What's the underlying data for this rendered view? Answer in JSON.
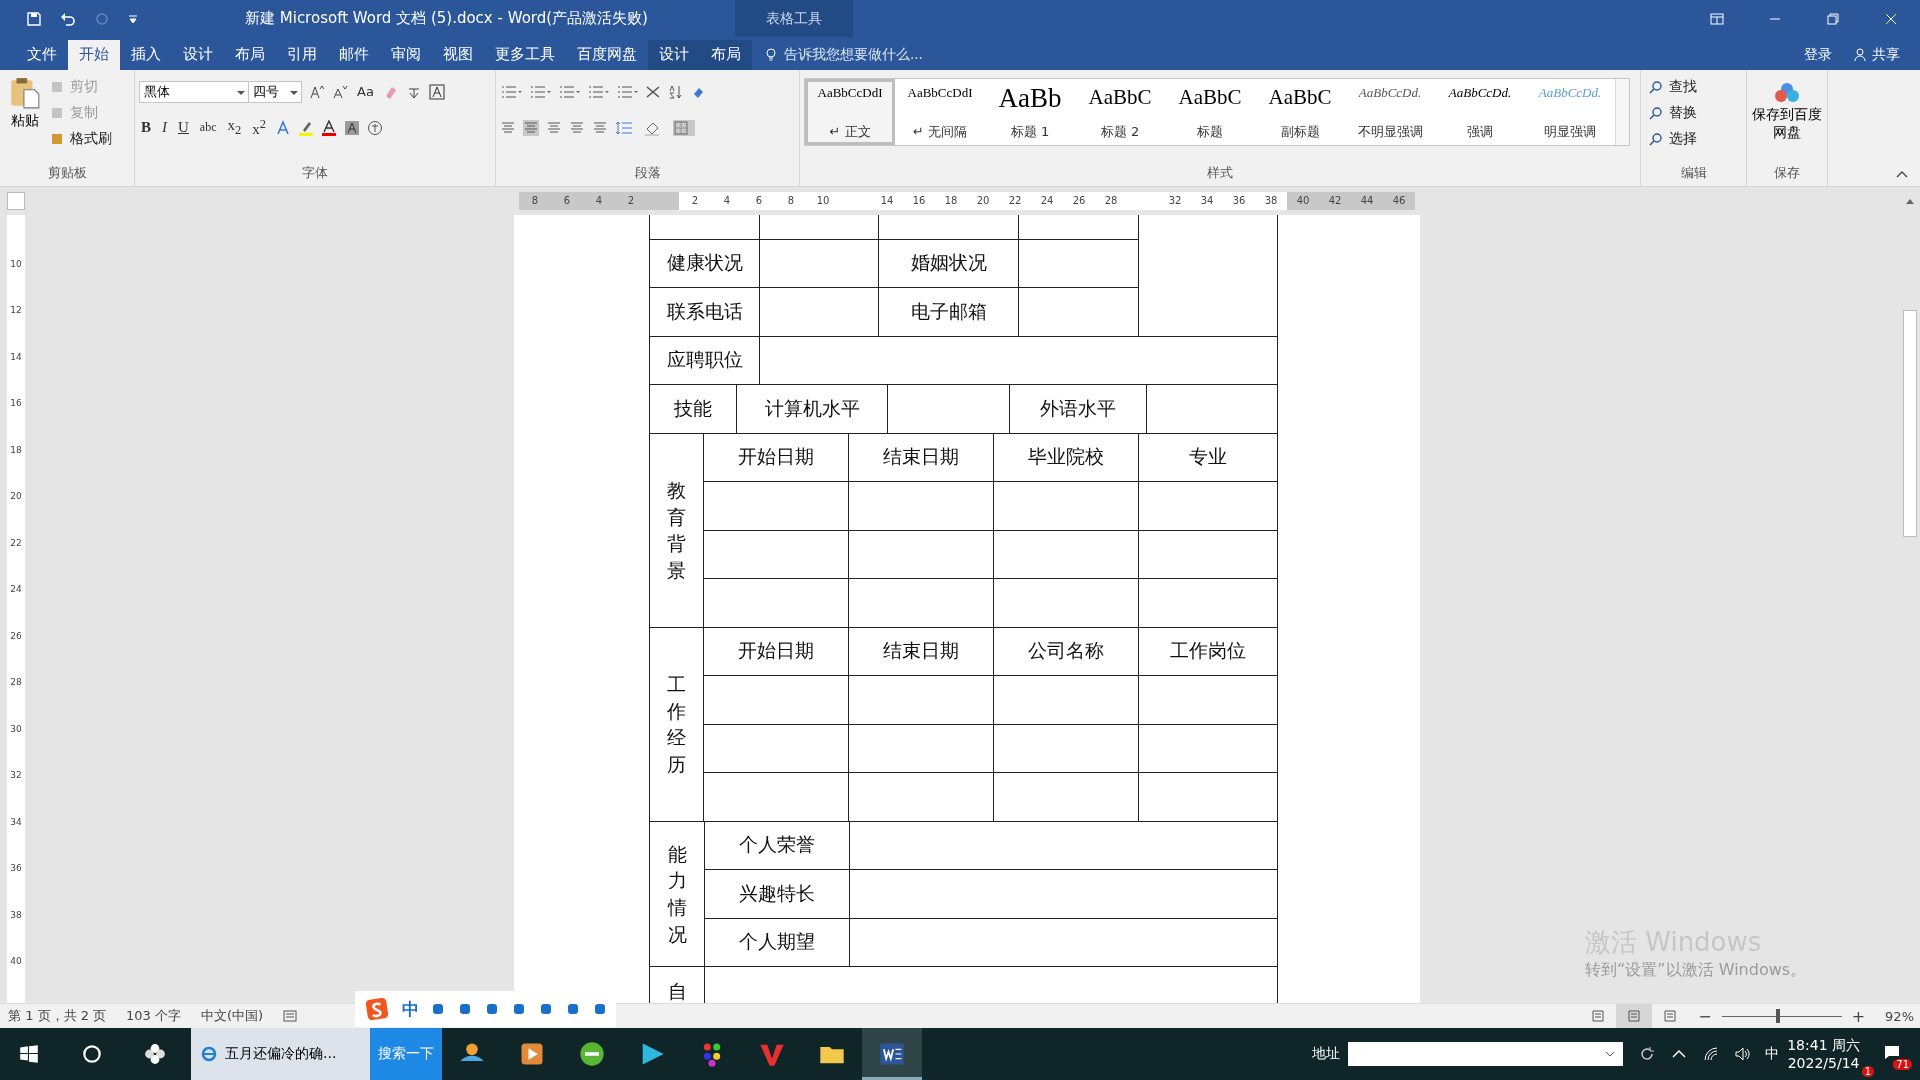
{
  "window": {
    "title": "新建 Microsoft Word 文档 (5).docx - Word(产品激活失败)",
    "context_group": "表格工具"
  },
  "menu_tabs": [
    {
      "label": "文件",
      "selected": false,
      "kind": "file"
    },
    {
      "label": "开始",
      "selected": true,
      "kind": "main"
    },
    {
      "label": "插入",
      "selected": false,
      "kind": "main"
    },
    {
      "label": "设计",
      "selected": false,
      "kind": "main"
    },
    {
      "label": "布局",
      "selected": false,
      "kind": "main"
    },
    {
      "label": "引用",
      "selected": false,
      "kind": "main"
    },
    {
      "label": "邮件",
      "selected": false,
      "kind": "main"
    },
    {
      "label": "审阅",
      "selected": false,
      "kind": "main"
    },
    {
      "label": "视图",
      "selected": false,
      "kind": "main"
    },
    {
      "label": "更多工具",
      "selected": false,
      "kind": "main"
    },
    {
      "label": "百度网盘",
      "selected": false,
      "kind": "main"
    },
    {
      "label": "设计",
      "selected": false,
      "kind": "context"
    },
    {
      "label": "布局",
      "selected": false,
      "kind": "context"
    }
  ],
  "tell_me": {
    "placeholder": "告诉我您想要做什么..."
  },
  "account": {
    "sign_in": "登录",
    "share": "共享"
  },
  "clipboard": {
    "paste": "粘贴",
    "items": [
      {
        "label": "剪切",
        "disabled": true
      },
      {
        "label": "复制",
        "disabled": true
      },
      {
        "label": "格式刷",
        "disabled": false
      }
    ],
    "label": "剪贴板"
  },
  "font": {
    "name": "黑体",
    "size": "四号",
    "case_button": "Aa",
    "format_buttons": [
      "B",
      "I",
      "U",
      "abc",
      "x$_{2}$",
      "x$^{2}$"
    ],
    "label": "字体"
  },
  "paragraph": {
    "label": "段落"
  },
  "styles": {
    "items": [
      {
        "preview": "AaBbCcDdI",
        "name": "↵ 正文",
        "selected": true,
        "kind": "body"
      },
      {
        "preview": "AaBbCcDdI",
        "name": "↵ 无间隔",
        "selected": false,
        "kind": "body"
      },
      {
        "preview": "AaBb",
        "name": "标题 1",
        "selected": false,
        "kind": "h1"
      },
      {
        "preview": "AaBbC",
        "name": "标题 2",
        "selected": false,
        "kind": "h2"
      },
      {
        "preview": "AaBbC",
        "name": "标题",
        "selected": false,
        "kind": "h2"
      },
      {
        "preview": "AaBbC",
        "name": "副标题",
        "selected": false,
        "kind": "h2"
      },
      {
        "preview": "AaBbCcDd.",
        "name": "不明显强调",
        "selected": false,
        "kind": "subtle"
      },
      {
        "preview": "AaBbCcDd.",
        "name": "强调",
        "selected": false,
        "kind": "emphasis"
      },
      {
        "preview": "AaBbCcDd.",
        "name": "明显强调",
        "selected": false,
        "kind": "intense"
      }
    ],
    "label": "样式"
  },
  "editing": {
    "items": [
      "查找",
      "替换",
      "选择"
    ],
    "label": "编辑"
  },
  "save": {
    "button": "保存到百度网盘",
    "label": "保存"
  },
  "ruler": {
    "marks": [
      {
        "label": "8",
        "shaded": true
      },
      {
        "label": "6",
        "shaded": true
      },
      {
        "label": "4",
        "shaded": true
      },
      {
        "label": "2",
        "shaded": true
      },
      {
        "shaded": true
      },
      {
        "label": "2",
        "shaded": false
      },
      {
        "label": "4",
        "shaded": false
      },
      {
        "label": "6",
        "shaded": false
      },
      {
        "label": "8",
        "shaded": false
      },
      {
        "label": "10",
        "shaded": false
      },
      {
        "shaded": false
      },
      {
        "label": "14",
        "shaded": false
      },
      {
        "label": "16",
        "shaded": false
      },
      {
        "label": "18",
        "shaded": false
      },
      {
        "label": "20",
        "shaded": false
      },
      {
        "label": "22",
        "shaded": false
      },
      {
        "label": "24",
        "shaded": false
      },
      {
        "label": "26",
        "shaded": false
      },
      {
        "label": "28",
        "shaded": false
      },
      {
        "shaded": false
      },
      {
        "label": "32",
        "shaded": false
      },
      {
        "label": "34",
        "shaded": false
      },
      {
        "label": "36",
        "shaded": false
      },
      {
        "label": "38",
        "shaded": false
      },
      {
        "label": "40",
        "shaded": true
      },
      {
        "label": "42",
        "shaded": true
      },
      {
        "label": "44",
        "shaded": true
      },
      {
        "label": "46",
        "shaded": true
      }
    ]
  },
  "vertical_ruler": [
    "10",
    "12",
    "14",
    "16",
    "18",
    "20",
    "22",
    "24",
    "26",
    "28",
    "30",
    "32",
    "34",
    "36",
    "38",
    "40"
  ],
  "form": {
    "personal_rows": [
      {
        "label_1": "健康状况",
        "label_2": "婚姻状况"
      },
      {
        "label_1": "联系电话",
        "label_2": "电子邮箱"
      }
    ],
    "position_row": {
      "label": "应聘职位"
    },
    "skills_row": {
      "label": "技能",
      "items": [
        "计算机水平",
        "外语水平"
      ]
    },
    "sections": [
      {
        "title": "教育背景",
        "headers": [
          "开始日期",
          "结束日期",
          "毕业院校",
          "专业"
        ]
      },
      {
        "title": "工作经历",
        "headers": [
          "开始日期",
          "结束日期",
          "公司名称",
          "工作岗位"
        ]
      }
    ],
    "ability": {
      "title": "能力情况",
      "items": [
        "个人荣誉",
        "兴趣特长",
        "个人期望"
      ]
    },
    "last_row": {
      "title": "自"
    }
  },
  "watermark": {
    "title": "激活 Windows",
    "hint": "转到“设置”以激活 Windows。"
  },
  "status_bar": {
    "page": "第 1 页，共 2 页",
    "words": "103 个字",
    "language": "中文(中国)",
    "views": [
      {
        "selected": false
      },
      {
        "selected": true
      },
      {
        "selected": false
      }
    ],
    "zoom": {
      "out": "−",
      "in": "+",
      "level": 0.45,
      "reading": "92%"
    }
  },
  "ime_toolbar": {
    "mode": "中"
  },
  "taskbar": {
    "search": {
      "value": "五月还偏冷的确...",
      "button": "搜索一下"
    },
    "address_label": "地址",
    "input_indicator": "中",
    "time": "18:41 周六",
    "date": "2022/5/14",
    "badge": "1",
    "notifications": "71"
  }
}
